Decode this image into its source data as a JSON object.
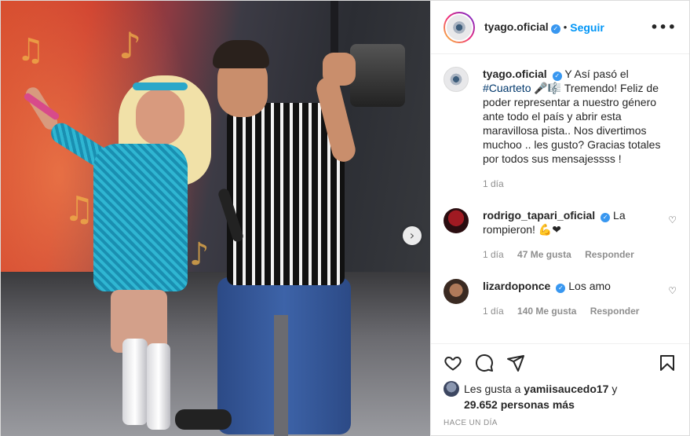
{
  "author": {
    "username": "tyago.oficial",
    "follow_label": "Seguir",
    "separator": "•",
    "more_label": "•••"
  },
  "caption": {
    "username": "tyago.oficial",
    "text_before_tag": "Y Así pasó el",
    "hashtag": "#Cuarteto",
    "emoji": "🎤🎼",
    "text_after_tag": "Tremendo! Feliz de poder representar a nuestro género ante todo el país y abrir esta maravillosa pista.. Nos divertimos muchoo .. les gusto? Gracias totales por todos sus mensajessss !",
    "time": "1 día"
  },
  "comments": [
    {
      "username": "rodrigo_tapari_oficial",
      "text": "La rompieron!",
      "emoji": "💪❤",
      "time": "1 día",
      "likes": "47 Me gusta",
      "reply": "Responder"
    },
    {
      "username": "lizardoponce",
      "text": "Los amo",
      "emoji": "",
      "time": "1 día",
      "likes": "140 Me gusta",
      "reply": "Responder"
    }
  ],
  "likes": {
    "prefix": "Les gusta a",
    "user": "yamiisaucedo17",
    "conj": "y",
    "count": "29.652 personas más"
  },
  "posted_ago": "HACE UN DÍA",
  "icons": {
    "heart": "heart-icon",
    "comment": "comment-icon",
    "share": "share-icon",
    "save": "bookmark-icon",
    "verified": "verified-badge-icon",
    "next": "chevron-right-icon"
  },
  "colors": {
    "link_blue": "#0095f6",
    "hashtag": "#00376b",
    "muted": "#8e8e8e",
    "verified": "#3897f0"
  }
}
